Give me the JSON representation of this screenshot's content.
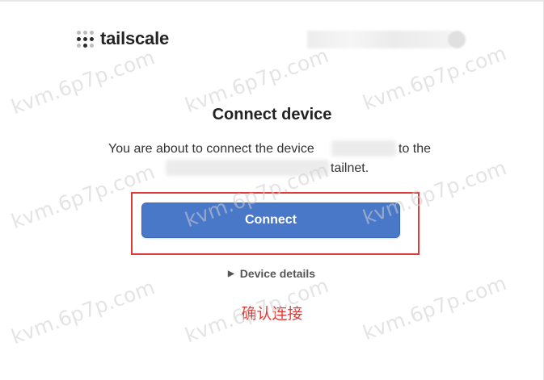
{
  "brand": {
    "name": "tailscale"
  },
  "dialog": {
    "title": "Connect device",
    "description_start": "You are about to connect the device",
    "description_mid": "to the",
    "description_end": "tailnet.",
    "connect_label": "Connect",
    "details_label": "Device details"
  },
  "annotation": {
    "text": "确认连接"
  },
  "watermark": {
    "text": "kvm.6p7p.com"
  },
  "colors": {
    "button": "#4a78c9",
    "highlight": "#e03b3b",
    "annotation": "#e53935"
  },
  "icons": {
    "logo": "tailscale-dots-icon",
    "expand": "triangle-right-icon"
  }
}
